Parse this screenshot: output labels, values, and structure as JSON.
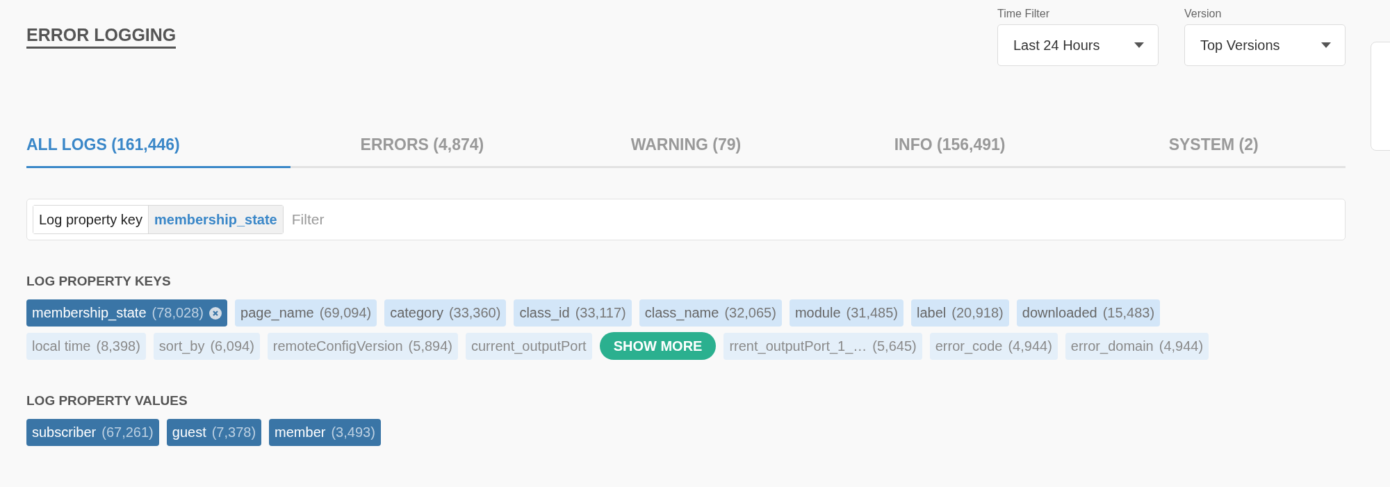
{
  "title": "ERROR LOGGING",
  "filters": [
    {
      "label": "Time Filter",
      "value": "Last 24 Hours"
    },
    {
      "label": "Version",
      "value": "Top Versions"
    }
  ],
  "tabs": [
    {
      "label": "ALL LOGS (161,446)",
      "selected": true
    },
    {
      "label": "ERRORS (4,874)",
      "selected": false
    },
    {
      "label": "WARNING (79)",
      "selected": false
    },
    {
      "label": "INFO (156,491)",
      "selected": false
    },
    {
      "label": "SYSTEM (2)",
      "selected": false
    }
  ],
  "filter_bar": {
    "token_key": "Log property key",
    "token_value": "membership_state",
    "placeholder": "Filter"
  },
  "keys_section": {
    "heading": "LOG PROPERTY KEYS",
    "chips": [
      {
        "name": "membership_state",
        "count": "(78,028)",
        "selected": true
      },
      {
        "name": "page_name",
        "count": "(69,094)",
        "selected": false
      },
      {
        "name": "category",
        "count": "(33,360)",
        "selected": false
      },
      {
        "name": "class_id",
        "count": "(33,117)",
        "selected": false
      },
      {
        "name": "class_name",
        "count": "(32,065)",
        "selected": false
      },
      {
        "name": "module",
        "count": "(31,485)",
        "selected": false
      },
      {
        "name": "label",
        "count": "(20,918)",
        "selected": false
      },
      {
        "name": "downloaded",
        "count": "(15,483)",
        "selected": false
      }
    ],
    "faded_row": [
      {
        "kind": "chip",
        "name": "local time",
        "count": "(8,398)"
      },
      {
        "kind": "chip",
        "name": "sort_by",
        "count": "(6,094)"
      },
      {
        "kind": "chip",
        "name": "remoteConfigVersion",
        "count": "(5,894)"
      },
      {
        "kind": "chip",
        "name": "current_outputPort"
      },
      {
        "kind": "button",
        "name": "SHOW MORE"
      },
      {
        "kind": "chip",
        "name": "rrent_outputPort_1_…",
        "count": "(5,645)"
      },
      {
        "kind": "chip",
        "name": "error_code",
        "count": "(4,944)"
      },
      {
        "kind": "chip",
        "name": "error_domain",
        "count": "(4,944)"
      }
    ]
  },
  "values_section": {
    "heading": "LOG PROPERTY VALUES",
    "chips": [
      {
        "name": "subscriber",
        "count": "(67,261)",
        "selected": true
      },
      {
        "name": "guest",
        "count": "(7,378)",
        "selected": true
      },
      {
        "name": "member",
        "count": "(3,493)",
        "selected": true
      }
    ]
  }
}
